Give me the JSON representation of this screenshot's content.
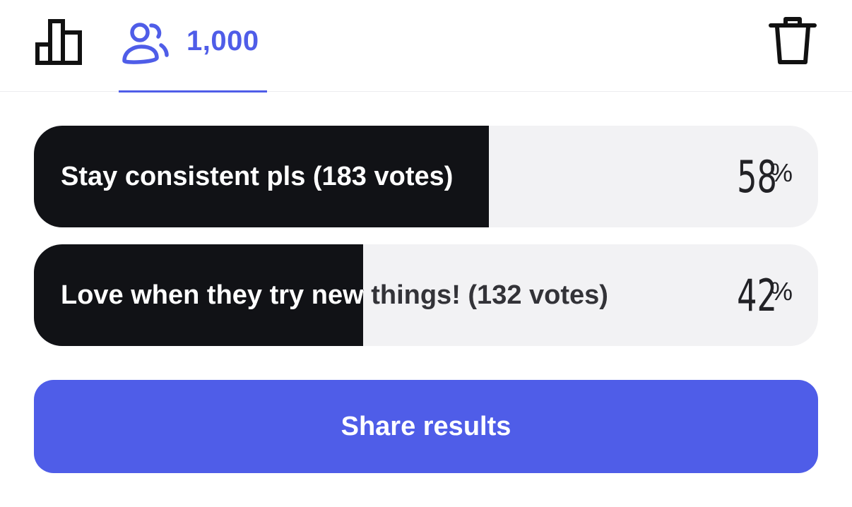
{
  "header": {
    "voter_count": "1,000",
    "icons": [
      "bar-chart-icon",
      "people-icon",
      "trash-icon"
    ],
    "accent_color": "#4f5de8"
  },
  "poll": {
    "options": [
      {
        "label": "Stay consistent pls (183 votes)",
        "percent": 58,
        "percent_text": "58",
        "percent_symbol": "%"
      },
      {
        "label": "Love when they try new things! (132 votes)",
        "percent": 42,
        "percent_text": "42",
        "percent_symbol": "%"
      }
    ],
    "fill_color": "#111216",
    "track_color": "#f2f2f4"
  },
  "share_button": {
    "label": "Share results",
    "color": "#4f5de8"
  }
}
